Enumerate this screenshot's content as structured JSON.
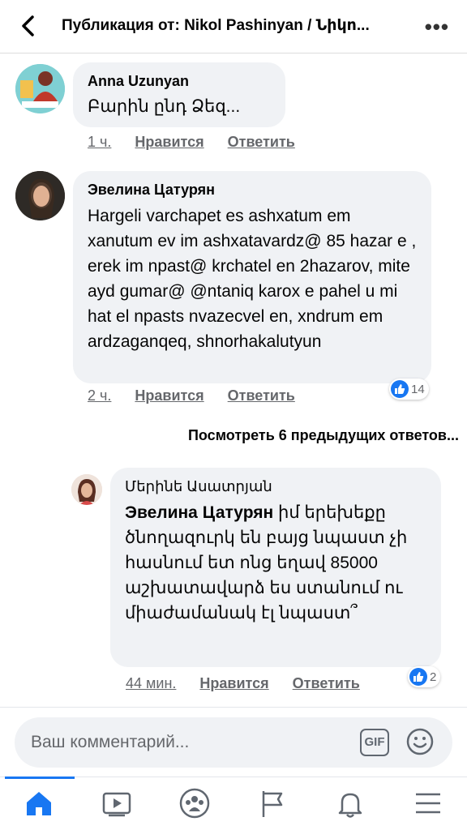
{
  "header": {
    "title": "Публикация от: Nikol Pashinyan / Նիկո..."
  },
  "comments": [
    {
      "author": "Anna Uzunyan",
      "text": "Բարին ընդ Ձեզ...",
      "time": "1 ч.",
      "like": "Нравится",
      "reply": "Ответить"
    },
    {
      "author": "Эвелина Цатурян",
      "text": "Hargeli varchapet es ashxatum em xanutum ev im ashxatavardz@ 85 hazar e , erek im npast@ krchatel en 2hazarov, mite ayd gumar@ @ntaniq karox e pahel u mi hat el npasts nvazecvel en, xndrum em ardzaganqeq, shnorhakalutyun",
      "time": "2 ч.",
      "like": "Нравится",
      "reply": "Ответить",
      "reactions": "14"
    }
  ],
  "view_more": "Посмотреть 6 предыдущих ответов...",
  "reply": {
    "author": "Մերինե Ասատրյան",
    "mention": "Эвелина Цатурян",
    "text": " իմ երեխեքը ծնողազուրկ են բայց նպաստ չի հասնում ետ ոնց եղավ 85000 աշխատավարձ ես ստանում ու միաժամանակ էլ նպաստ՞",
    "time": "44 мин.",
    "like": "Нравится",
    "reply_label": "Ответить",
    "reactions": "2"
  },
  "composer": {
    "placeholder": "Ваш комментарий...",
    "gif": "GIF"
  },
  "icons": {
    "back": "back-chevron-icon",
    "more": "more-dots-icon",
    "like": "like-thumb-icon",
    "smile": "emoji-icon",
    "tabs": [
      "home-icon",
      "video-icon",
      "groups-icon",
      "pages-flag-icon",
      "bell-icon",
      "menu-icon"
    ]
  },
  "colors": {
    "accent": "#1877f2",
    "bubble": "#f0f2f5",
    "secondary_text": "#65676b"
  }
}
